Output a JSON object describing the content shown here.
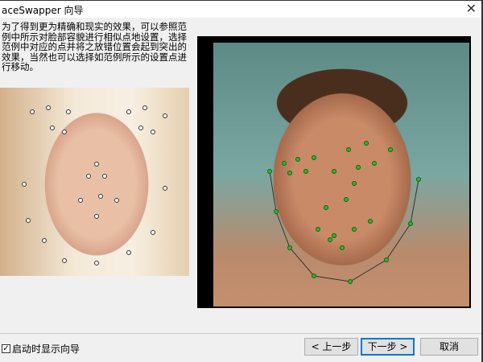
{
  "window": {
    "title": "aceSwapper 向导",
    "close_icon": "close-icon"
  },
  "description": "为了得到更为精确和现实的效果，可以参照范例中所示对脸部容貌进行相似点地设置，选择范例中对应的点并将之放错位置会起到突出的效果，当然也可以选择如范例所示的设置点进行移动。",
  "footer": {
    "show_on_start_label": "启动时显示向导",
    "show_on_start_checked": true,
    "back_label": "< 上一步",
    "next_label": "下一步 >",
    "cancel_label": "取消"
  },
  "colors": {
    "landmark_sample": "#ffffff",
    "landmark_photo": "#22c022"
  }
}
